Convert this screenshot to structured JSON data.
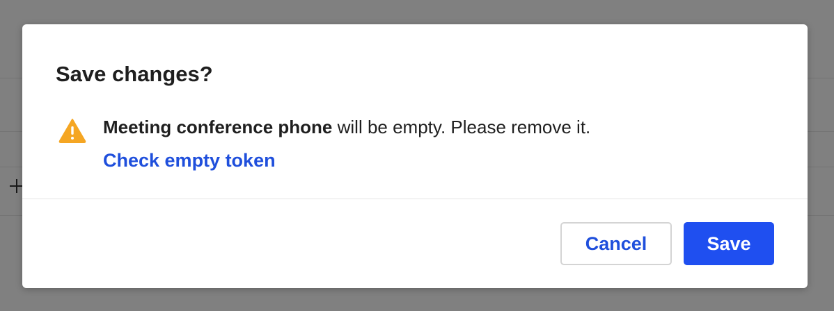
{
  "dialog": {
    "title": "Save changes?",
    "warning": {
      "icon": "warning-icon",
      "icon_color": "#F5A623",
      "field_name": "Meeting conference phone",
      "message": " will be empty. Please remove it."
    },
    "link_label": "Check empty token",
    "buttons": {
      "cancel_label": "Cancel",
      "save_label": "Save"
    }
  },
  "colors": {
    "accent": "#1F4FF0",
    "link": "#1F4FDC",
    "overlay": "#808080"
  }
}
